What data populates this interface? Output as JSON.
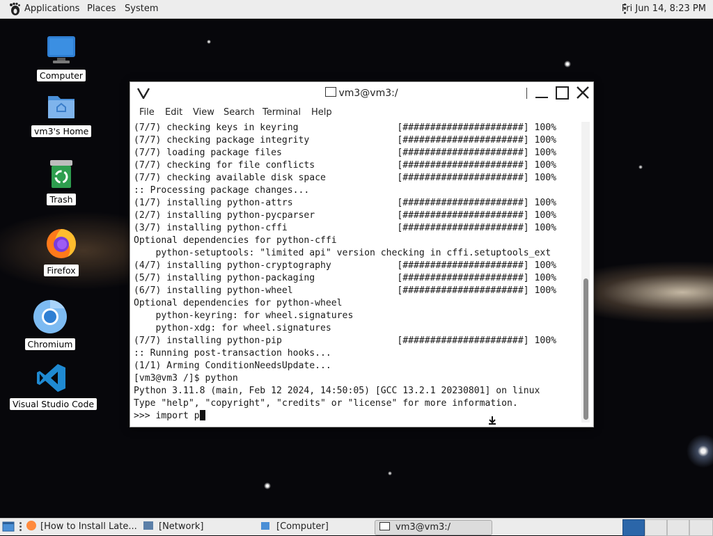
{
  "top_panel": {
    "applications": "Applications",
    "places": "Places",
    "system": "System",
    "clock": "Fri Jun 14,  8:23 PM"
  },
  "desktop": {
    "icons": [
      {
        "label": "Computer",
        "icon": "monitor-icon"
      },
      {
        "label": "vm3's Home",
        "icon": "home-folder-icon"
      },
      {
        "label": "Trash",
        "icon": "trash-icon"
      },
      {
        "label": "Firefox",
        "icon": "firefox-icon"
      },
      {
        "label": "Chromium",
        "icon": "chromium-icon"
      },
      {
        "label": "Visual Studio Code",
        "icon": "vscode-icon"
      }
    ]
  },
  "terminal": {
    "title": "vm3@vm3:/",
    "menu": [
      "File",
      "Edit",
      "View",
      "Search",
      "Terminal",
      "Help"
    ],
    "lines": [
      "(7/7) checking keys in keyring                  [######################] 100%",
      "(7/7) checking package integrity                [######################] 100%",
      "(7/7) loading package files                     [######################] 100%",
      "(7/7) checking for file conflicts               [######################] 100%",
      "(7/7) checking available disk space             [######################] 100%",
      ":: Processing package changes...",
      "(1/7) installing python-attrs                   [######################] 100%",
      "(2/7) installing python-pycparser               [######################] 100%",
      "(3/7) installing python-cffi                    [######################] 100%",
      "Optional dependencies for python-cffi",
      "    python-setuptools: \"limited api\" version checking in cffi.setuptools_ext",
      "(4/7) installing python-cryptography            [######################] 100%",
      "(5/7) installing python-packaging               [######################] 100%",
      "(6/7) installing python-wheel                   [######################] 100%",
      "Optional dependencies for python-wheel",
      "    python-keyring: for wheel.signatures",
      "    python-xdg: for wheel.signatures",
      "(7/7) installing python-pip                     [######################] 100%",
      ":: Running post-transaction hooks...",
      "(1/1) Arming ConditionNeedsUpdate...",
      "[vm3@vm3 /]$ python",
      "Python 3.11.8 (main, Feb 12 2024, 14:50:05) [GCC 13.2.1 20230801] on linux",
      "Type \"help\", \"copyright\", \"credits\" or \"license\" for more information.",
      ">>> import p"
    ]
  },
  "taskbar": {
    "tasks": [
      {
        "label": "[How to Install Late...",
        "icon": "firefox-icon"
      },
      {
        "label": "[Network]",
        "icon": "network-icon"
      },
      {
        "label": "[Computer]",
        "icon": "computer-icon"
      },
      {
        "label": "vm3@vm3:/",
        "icon": "terminal-icon"
      }
    ],
    "active_task": 3,
    "workspaces": 4,
    "active_workspace": 0
  },
  "colors": {
    "panel": "#ededed",
    "workspace_active": "#2b66a9",
    "vscode_blue": "#1f8ad2"
  }
}
